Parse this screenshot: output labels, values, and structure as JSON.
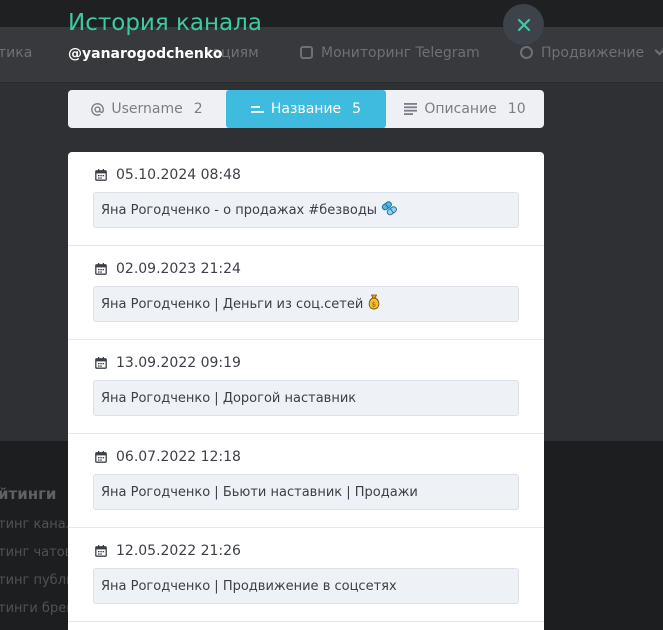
{
  "background": {
    "nav": [
      "тика",
      "кациям",
      "Мониторинг Telegram",
      "Продвижение"
    ],
    "footer": {
      "title": "йтинги",
      "links": [
        "тинг канал",
        "тинг чатов",
        "тинг публи",
        "тинги брен"
      ]
    }
  },
  "modal": {
    "title": "История канала",
    "subtitle": "@yanarogodchenko",
    "close_icon": "close-icon",
    "accent_color": "#3ec9a1",
    "active_tab_color": "#3fbbdf"
  },
  "tabs": [
    {
      "label": "Username",
      "count": "2",
      "icon": "at-icon",
      "active": false
    },
    {
      "label": "Название",
      "count": "5",
      "icon": "lines-icon",
      "active": true
    },
    {
      "label": "Описание",
      "count": "10",
      "icon": "text-lines-icon",
      "active": false
    }
  ],
  "history": [
    {
      "date": "05.10.2024 08:48",
      "value": "Яна Рогодченко - о продажах #безводы",
      "emoji": "pills-icon"
    },
    {
      "date": "02.09.2023 21:24",
      "value": "Яна Рогодченко | Деньги из соц.сетей",
      "emoji": "money-bag-icon"
    },
    {
      "date": "13.09.2022 09:19",
      "value": "Яна Рогодченко | Дорогой наставник",
      "emoji": ""
    },
    {
      "date": "06.07.2022 12:18",
      "value": "Яна Рогодченко | Бьюти наставник | Продажи",
      "emoji": ""
    },
    {
      "date": "12.05.2022 21:26",
      "value": "Яна Рогодченко | Продвижение в соцсетях",
      "emoji": ""
    }
  ]
}
